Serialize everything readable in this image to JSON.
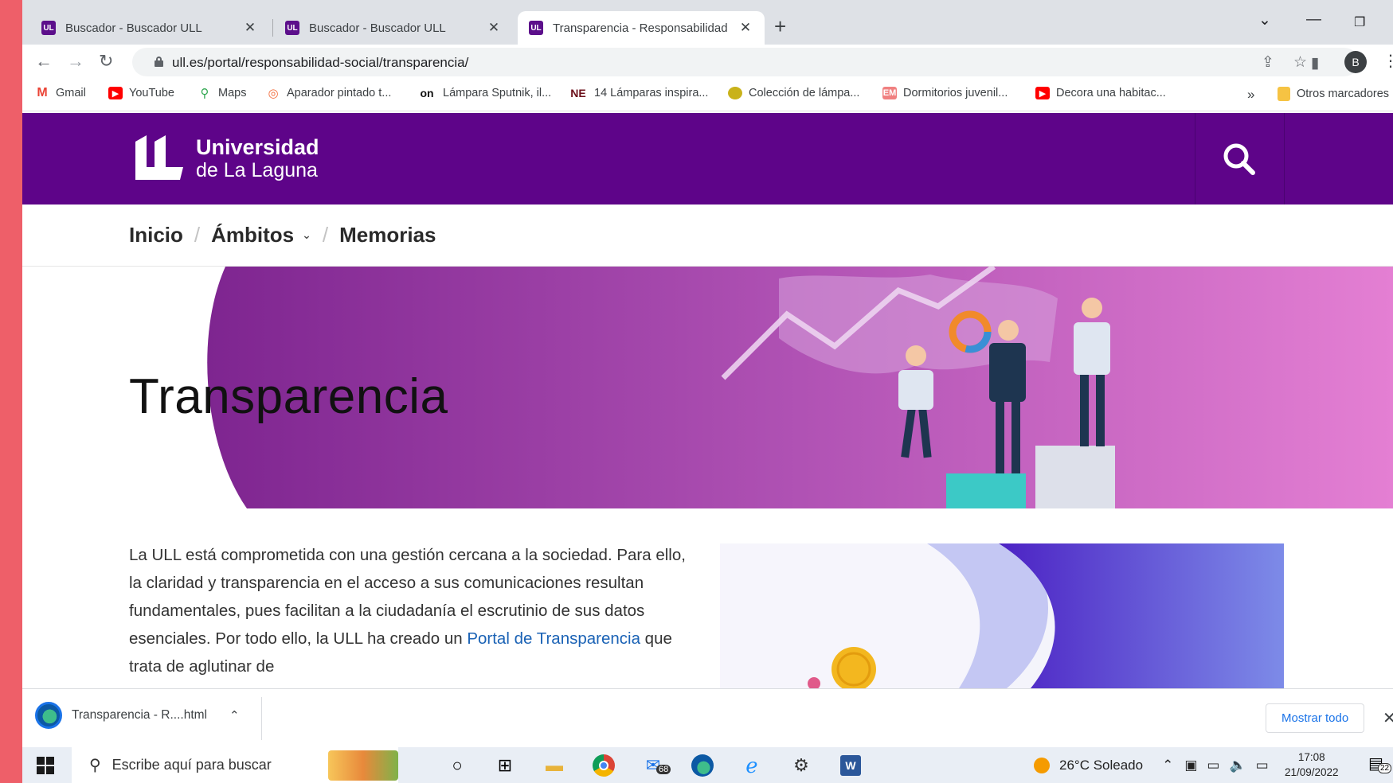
{
  "browser": {
    "tabs": [
      {
        "title": "Buscador - Buscador ULL",
        "active": false
      },
      {
        "title": "Buscador - Buscador ULL",
        "active": false
      },
      {
        "title": "Transparencia - Responsabilidad",
        "active": true
      }
    ],
    "url": "ull.es/portal/responsabilidad-social/transparencia/",
    "profile_initial": "B",
    "bookmarks": [
      {
        "label": "Gmail",
        "icon": "gmail-icon"
      },
      {
        "label": "YouTube",
        "icon": "youtube-icon"
      },
      {
        "label": "Maps",
        "icon": "maps-icon"
      },
      {
        "label": "Aparador pintado t...",
        "icon": "pin-icon"
      },
      {
        "label": "Lámpara Sputnik, il...",
        "icon": "on-icon"
      },
      {
        "label": "14 Lámparas inspira...",
        "icon": "ne-icon"
      },
      {
        "label": "Colección de lámpa...",
        "icon": "lamp-icon"
      },
      {
        "label": "Dormitorios juvenil...",
        "icon": "em-icon"
      },
      {
        "label": "Decora una habitac...",
        "icon": "youtube-icon"
      }
    ],
    "bookmarks_more": "»",
    "other_bookmarks": "Otros marcadores"
  },
  "site": {
    "brand_line1": "Universidad",
    "brand_line2": "de La Laguna",
    "breadcrumb": [
      "Inicio",
      "Ámbitos",
      "Memorias"
    ],
    "hero_title": "Transparencia",
    "intro_before_link": "La ULL está comprometida con una gestión cercana a la sociedad. Para ello, la claridad y transparencia en el acceso a sus comunicaciones resultan fundamentales, pues facilitan a la ciudadanía el escrutinio de sus datos esenciales. Por todo ello, la ULL ha creado un ",
    "intro_link": "Portal de Transparencia",
    "intro_after_link": "  que trata de aglutinar de"
  },
  "download": {
    "filename": "Transparencia - R....html",
    "show_all": "Mostrar todo"
  },
  "taskbar": {
    "search_placeholder": "Escribe aquí para buscar",
    "mail_badge": "68",
    "weather": "26°C  Soleado",
    "time": "17:08",
    "date": "21/09/2022",
    "notifications": "22"
  },
  "colors": {
    "brand_purple": "#5e0489",
    "outer_background": "#ee5f69",
    "link": "#1a62b5"
  }
}
